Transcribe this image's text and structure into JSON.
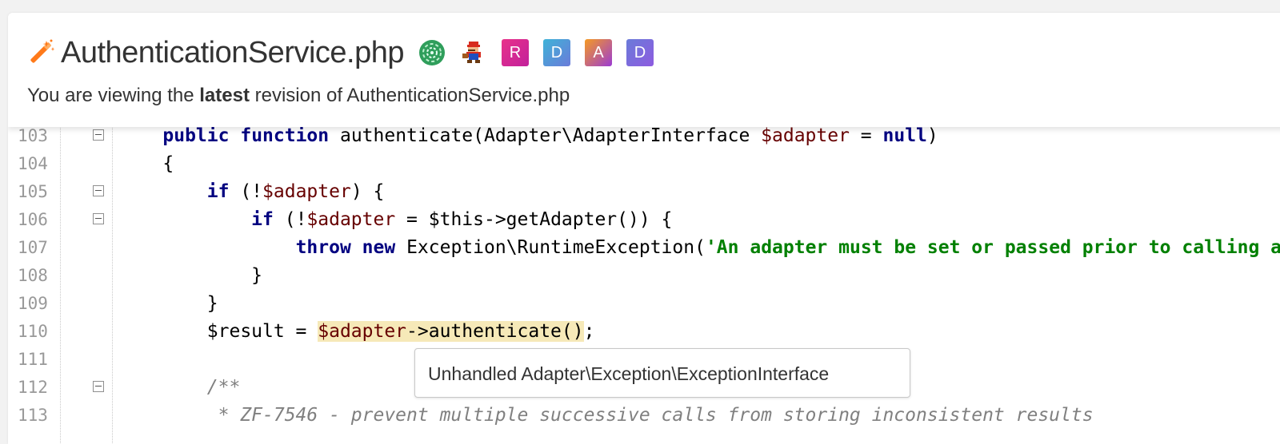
{
  "header": {
    "title": "AuthenticationService.php",
    "subtitle_pre": "You are viewing the ",
    "subtitle_bold": "latest",
    "subtitle_post": " revision of AuthenticationService.php",
    "title_icon": "magic-wand-icon",
    "avatars": [
      {
        "kind": "image",
        "name": "green-swirl-avatar"
      },
      {
        "kind": "image",
        "name": "mario-avatar"
      },
      {
        "kind": "letter",
        "letter": "R",
        "color_from": "#e8318a",
        "color_to": "#c2219b"
      },
      {
        "kind": "letter",
        "letter": "D",
        "color_from": "#3fb3d8",
        "color_to": "#6a7bd9"
      },
      {
        "kind": "letter",
        "letter": "A",
        "color_from": "#f59a23",
        "color_to": "#9b3bd3"
      },
      {
        "kind": "letter",
        "letter": "D",
        "color_from": "#6a7bd9",
        "color_to": "#8e5be0"
      }
    ]
  },
  "code": {
    "lines": [
      {
        "number": "103",
        "fold": true
      },
      {
        "number": "104",
        "fold": false
      },
      {
        "number": "105",
        "fold": true
      },
      {
        "number": "106",
        "fold": true
      },
      {
        "number": "107",
        "fold": false
      },
      {
        "number": "108",
        "fold": false
      },
      {
        "number": "109",
        "fold": false
      },
      {
        "number": "110",
        "fold": false
      },
      {
        "number": "111",
        "fold": false
      },
      {
        "number": "112",
        "fold": true
      },
      {
        "number": "113",
        "fold": false
      }
    ],
    "tokens": {
      "l103": [
        "    ",
        "public",
        " ",
        "function",
        " authenticate(Adapter\\AdapterInterface ",
        "$adapter",
        " = ",
        "null",
        ")"
      ],
      "l104": [
        "    {"
      ],
      "l105": [
        "        ",
        "if",
        " (!",
        "$adapter",
        ") {"
      ],
      "l106": [
        "            ",
        "if",
        " (!",
        "$adapter",
        " = $this->getAdapter()) {"
      ],
      "l107": [
        "                ",
        "throw",
        " ",
        "new",
        " Exception\\RuntimeException(",
        "'An adapter must be set or passed prior to calling authenticate()'"
      ],
      "l108": [
        "            }"
      ],
      "l109": [
        "        }"
      ],
      "l110": [
        "        $result = ",
        "$adapter",
        "->authenticate()",
        ";"
      ],
      "l111": [
        ""
      ],
      "l112": [
        "        ",
        "/**"
      ],
      "l113": [
        "         ",
        "* ZF-7546 - prevent multiple successive calls from storing inconsistent results"
      ]
    }
  },
  "tooltip": {
    "text": "Unhandled Adapter\\Exception\\ExceptionInterface"
  },
  "colors": {
    "keyword": "#000080",
    "variable": "#660000",
    "string": "#008000",
    "comment": "#808080",
    "highlight": "#f6e9b8"
  }
}
